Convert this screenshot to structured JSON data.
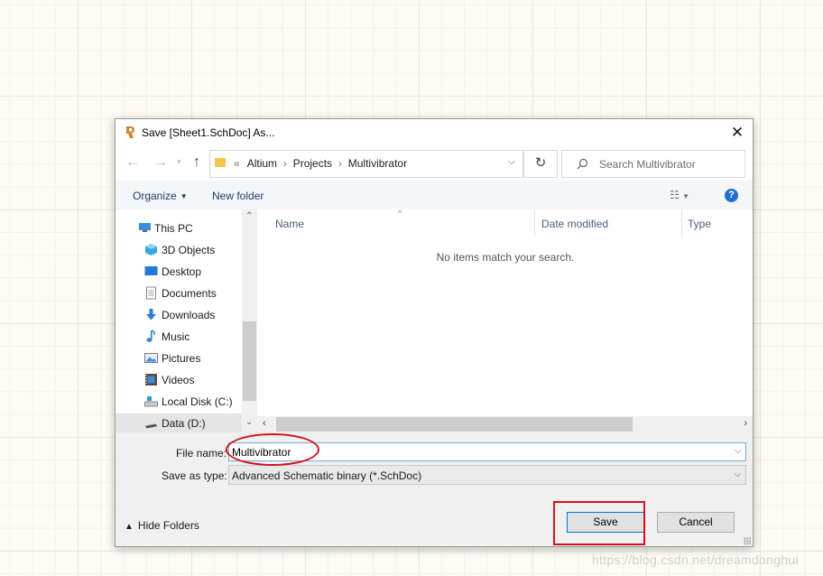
{
  "dialog": {
    "title": "Save [Sheet1.SchDoc] As...",
    "close_icon": "close-icon",
    "app_icon": "altium-icon"
  },
  "navigation": {
    "back_icon": "back-arrow-icon",
    "forward_icon": "forward-arrow-icon",
    "recent_icon": "chevron-down-icon",
    "up_icon": "up-arrow-icon",
    "breadcrumb_prefix": "«",
    "breadcrumbs": [
      "Altium",
      "Projects",
      "Multivibrator"
    ],
    "refresh_icon": "refresh-icon",
    "search_placeholder": "Search Multivibrator"
  },
  "toolbar": {
    "organize_label": "Organize",
    "new_folder_label": "New folder",
    "view_icon": "view-options-icon",
    "help_label": "?"
  },
  "sidebar": {
    "items": [
      {
        "label": "This PC",
        "icon": "computer-icon"
      },
      {
        "label": "3D Objects",
        "icon": "3d-objects-icon"
      },
      {
        "label": "Desktop",
        "icon": "desktop-icon"
      },
      {
        "label": "Documents",
        "icon": "documents-icon"
      },
      {
        "label": "Downloads",
        "icon": "downloads-icon"
      },
      {
        "label": "Music",
        "icon": "music-icon"
      },
      {
        "label": "Pictures",
        "icon": "pictures-icon"
      },
      {
        "label": "Videos",
        "icon": "videos-icon"
      },
      {
        "label": "Local Disk (C:)",
        "icon": "local-disk-icon"
      },
      {
        "label": "Data (D:)",
        "icon": "data-drive-icon"
      }
    ]
  },
  "file_list": {
    "columns": [
      "Name",
      "Date modified",
      "Type"
    ],
    "empty_message": "No items match your search."
  },
  "form": {
    "file_name_label": "File name:",
    "file_name_value": "Multivibrator",
    "save_type_label": "Save as type:",
    "save_type_value": "Advanced Schematic binary (*.SchDoc)"
  },
  "footer": {
    "hide_folders_label": "Hide Folders",
    "save_label": "Save",
    "cancel_label": "Cancel"
  },
  "annotations": {
    "color": "#d4121b"
  },
  "watermark": "https://blog.csdn.net/dreamdonghui"
}
